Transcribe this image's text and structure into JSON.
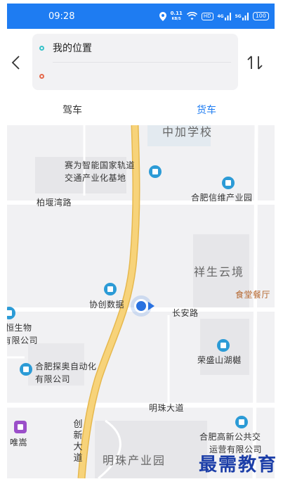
{
  "status_bar": {
    "time": "09:28",
    "speed_value": "0.11",
    "speed_unit": "KB/S",
    "hd_badge": "HD",
    "signal_1": "4G",
    "signal_2": "5G",
    "battery": "100"
  },
  "route": {
    "origin": "我的位置",
    "destination": ""
  },
  "modes": {
    "drive": "驾车",
    "truck": "货车",
    "active": "truck"
  },
  "colors": {
    "accent": "#1e7cf2",
    "origin_dot": "#36c2c9",
    "destination_dot": "#e5694b",
    "road_main": "#f7d37a"
  },
  "map": {
    "labels": {
      "school": "中加学校",
      "saiwei_line1": "赛为智能国家轨道",
      "saiwei_line2": "交通产业化基地",
      "xinwei": "合肥信维产业园",
      "baiyanwan_road": "柏堰湾路",
      "xiangsheng": "祥生云境",
      "canteen": "食堂餐厅",
      "xiechuang": "协创数据",
      "changan_road": "长安路",
      "hengsheng_line1": "恒生物",
      "hengsheng_line2": "有限公司",
      "rongsheng": "荣盛山湖樾",
      "tanao_line1": "合肥探奥自动化",
      "tanao_line2": "有限公司",
      "mingzhu_road": "明珠大道",
      "weisong": "唯嵩",
      "chuangxin_road": "创新大道",
      "transit_line1": "合肥高新公共交",
      "transit_line2": "运营有限公司",
      "mingzhu_park": "明珠产业园"
    }
  },
  "watermark": "最需教育"
}
